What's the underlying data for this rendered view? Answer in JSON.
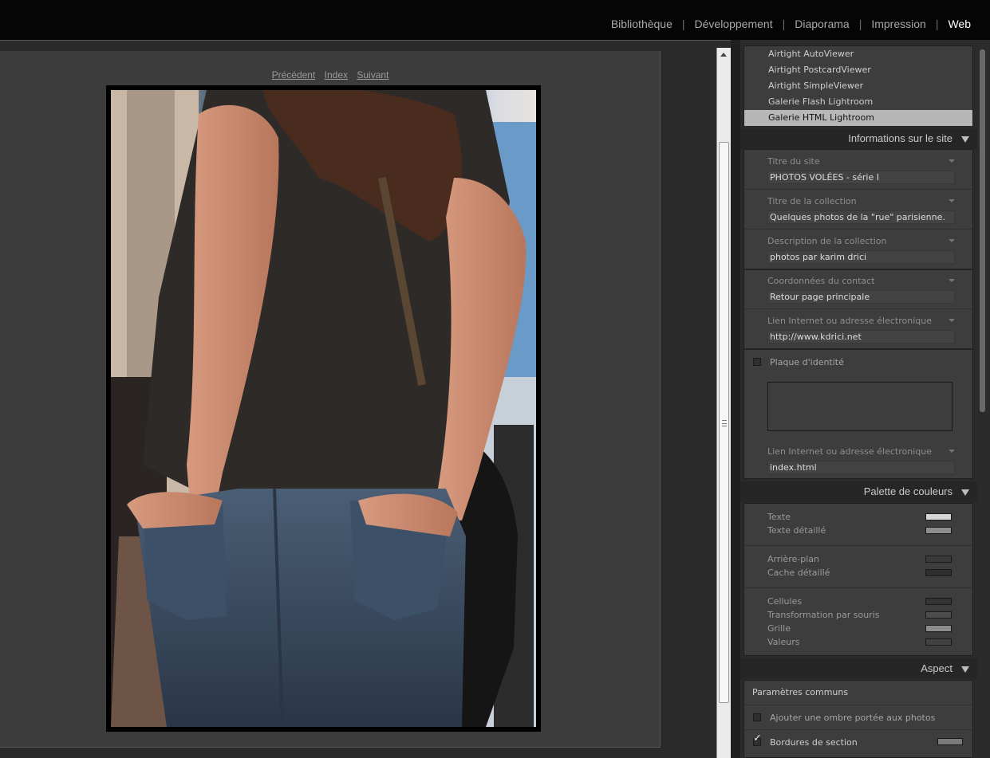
{
  "modules": {
    "items": [
      {
        "label": "Bibliothèque"
      },
      {
        "label": "Développement"
      },
      {
        "label": "Diaporama"
      },
      {
        "label": "Impression"
      },
      {
        "label": "Web"
      }
    ],
    "separator": "|",
    "active": "Web"
  },
  "preview": {
    "nav": {
      "prev": "Précédent",
      "index": "Index",
      "next": "Suivant"
    }
  },
  "templates": [
    {
      "label": "Airtight AutoViewer"
    },
    {
      "label": "Airtight PostcardViewer"
    },
    {
      "label": "Airtight SimpleViewer"
    },
    {
      "label": "Galerie Flash Lightroom"
    },
    {
      "label": "Galerie HTML Lightroom"
    }
  ],
  "site_info": {
    "header": "Informations sur le site",
    "fields": [
      {
        "label": "Titre du site",
        "value": "PHOTOS VOLÉES - série I"
      },
      {
        "label": "Titre de la collection",
        "value": "Quelques photos de la \"rue\" parisienne."
      },
      {
        "label": "Description de la collection",
        "value": "photos par karim drici"
      },
      {
        "label": "Coordonnées du contact",
        "value": "Retour page principale"
      },
      {
        "label": "Lien Internet ou adresse électronique",
        "value": "http://www.kdrici.net"
      }
    ],
    "identity_plate": {
      "label": "Plaque d'identité",
      "checked": false
    },
    "identity_link": {
      "label": "Lien Internet ou adresse électronique",
      "value": "index.html"
    }
  },
  "palette": {
    "header": "Palette de couleurs",
    "colors": [
      {
        "label": "Texte",
        "color": "#d6d6d6"
      },
      {
        "label": "Texte détaillé",
        "color": "#8f8f8f"
      },
      {
        "label": "Arrière-plan",
        "color": "#3a3a3a"
      },
      {
        "label": "Cache détaillé",
        "color": "#2e2e2e"
      },
      {
        "label": "Cellules",
        "color": "#333333"
      },
      {
        "label": "Transformation par souris",
        "color": "#4c4c4c"
      },
      {
        "label": "Grille",
        "color": "#8c8c8c"
      },
      {
        "label": "Valeurs",
        "color": "#424242"
      }
    ]
  },
  "aspect": {
    "header": "Aspect",
    "common_title": "Paramètres communs",
    "drop_shadow": {
      "label": "Ajouter une ombre portée aux photos",
      "checked": false
    },
    "section_borders": {
      "label": "Bordures de section",
      "checked": true,
      "color": "#7a7a7a"
    }
  }
}
